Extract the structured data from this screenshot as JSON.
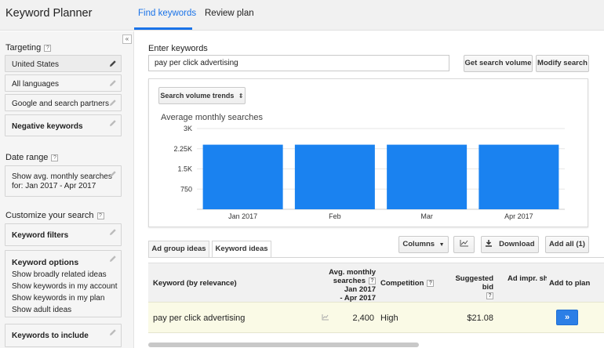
{
  "app": {
    "title": "Keyword Planner"
  },
  "nav": {
    "tabs": [
      "Find keywords",
      "Review plan"
    ]
  },
  "sidebar": {
    "collapse_glyph": "«",
    "targeting_label": "Targeting",
    "targeting_items": [
      "United States",
      "All languages",
      "Google and search partners",
      "Negative keywords"
    ],
    "date_range_label": "Date range",
    "date_range_value_line1": "Show avg. monthly searches",
    "date_range_value_line2": "for: Jan 2017 - Apr 2017",
    "customize_label": "Customize your search",
    "keyword_filters": "Keyword filters",
    "keyword_options": "Keyword options",
    "keyword_options_lines": [
      "Show broadly related ideas",
      "Show keywords in my account",
      "Show keywords in my plan",
      "Show adult ideas"
    ],
    "keywords_to_include": "Keywords to include"
  },
  "search": {
    "label": "Enter keywords",
    "value": "pay per click advertising",
    "get_volume": "Get search volume",
    "modify": "Modify search"
  },
  "chart": {
    "dropdown_label": "Search volume trends",
    "dropdown_icon": "updown-caret-icon"
  },
  "chart_data": {
    "type": "bar",
    "title": "Average monthly searches",
    "categories": [
      "Jan 2017",
      "Feb",
      "Mar",
      "Apr 2017"
    ],
    "values": [
      2400,
      2400,
      2400,
      2400
    ],
    "ylim": [
      0,
      3000
    ],
    "yticks": [
      "3K",
      "2.25K",
      "1.5K",
      "750"
    ],
    "ytick_values": [
      3000,
      2250,
      1500,
      750
    ],
    "bar_color": "#1a82f0",
    "grid": true
  },
  "ideas": {
    "tabs": [
      "Ad group ideas",
      "Keyword ideas"
    ],
    "columns_btn": "Columns",
    "download_btn": "Download",
    "add_all_btn": "Add all (1)"
  },
  "table": {
    "headers": {
      "keyword": "Keyword (by relevance)",
      "avg_line1": "Avg. monthly",
      "avg_line2": "searches",
      "avg_line3": "Jan 2017",
      "avg_line4": "- Apr 2017",
      "competition": "Competition",
      "bid": "Suggested bid",
      "impr": "Ad impr. sh",
      "add": "Add to plan"
    },
    "rows": [
      {
        "keyword": "pay per click advertising",
        "searches": "2,400",
        "competition": "High",
        "bid": "$21.08",
        "add_glyph": "»"
      }
    ]
  },
  "colors": {
    "accent": "#1a73e8",
    "bar": "#1a82f0",
    "row_highlight": "#fafae6"
  }
}
